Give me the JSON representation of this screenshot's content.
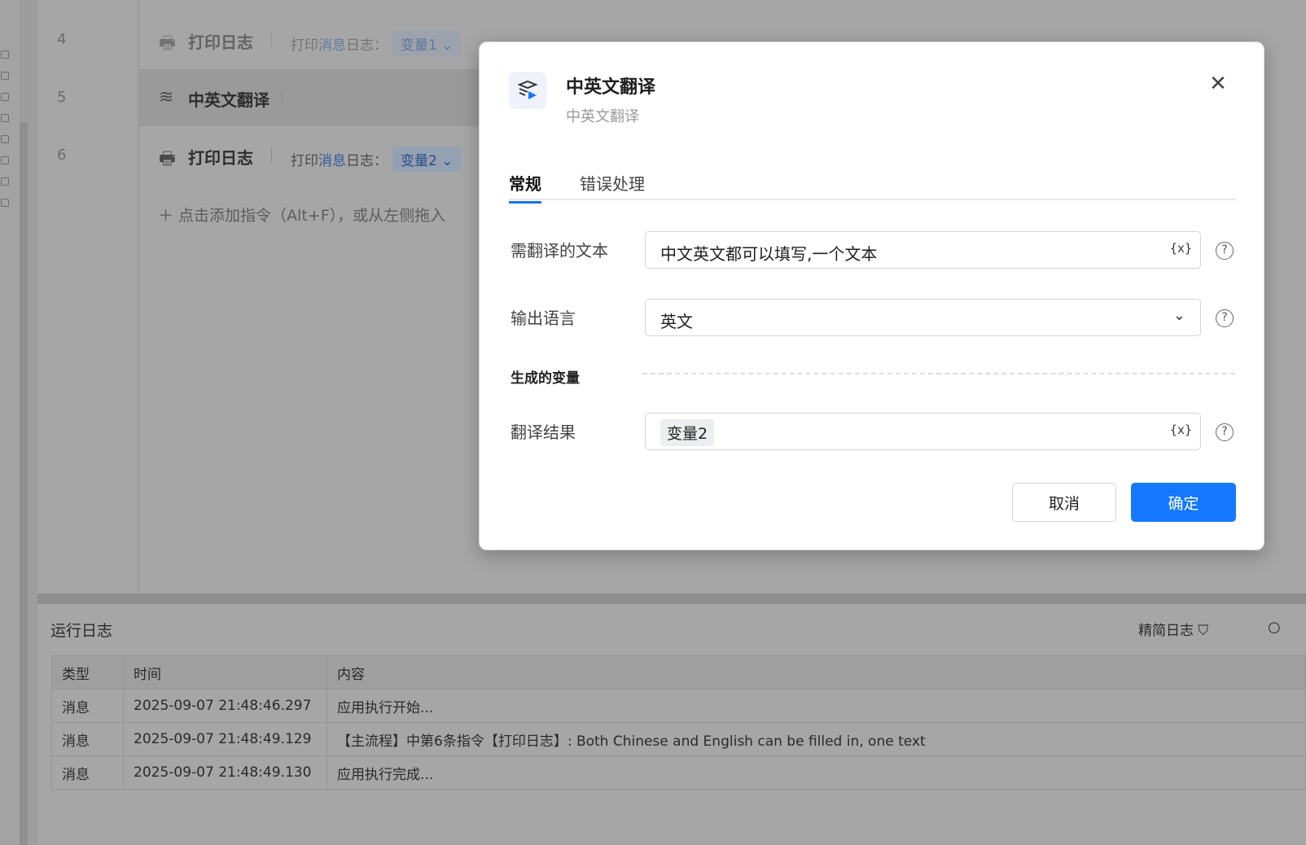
{
  "editor": {
    "rows": [
      {
        "line": "4",
        "icon": "printer-icon",
        "name": "打印日志",
        "desc_prefix": "打印",
        "desc_link": "消息",
        "desc_suffix": "日志：",
        "var": "变量1"
      },
      {
        "line": "5",
        "icon": "translate-icon",
        "name": "中英文翻译"
      },
      {
        "line": "6",
        "icon": "printer-icon",
        "name": "打印日志",
        "desc_prefix": "打印",
        "desc_link": "消息",
        "desc_suffix": "日志：",
        "var": "变量2"
      }
    ],
    "add_hint": "点击添加指令（Alt+F），或从左侧拖入"
  },
  "log": {
    "title": "运行日志",
    "filter_label": "精简日志",
    "columns": [
      "类型",
      "时间",
      "内容"
    ],
    "rows": [
      [
        "消息",
        "2025-09-07 21:48:46.297",
        "应用执行开始..."
      ],
      [
        "消息",
        "2025-09-07 21:48:49.129",
        "【主流程】中第6条指令【打印日志】: Both Chinese and English can be filled in, one text"
      ],
      [
        "消息",
        "2025-09-07 21:48:49.130",
        "应用执行完成..."
      ]
    ]
  },
  "dialog": {
    "title": "中英文翻译",
    "subtitle": "中英文翻译",
    "tabs": [
      "常规",
      "错误处理"
    ],
    "active_tab": "常规",
    "fields": {
      "text": {
        "label": "需翻译的文本",
        "value": "中文英文都可以填写,一个文本",
        "var_icon": "{x}"
      },
      "language": {
        "label": "输出语言",
        "value": "英文"
      },
      "section_title": "生成的变量",
      "result": {
        "label": "翻译结果",
        "value": "变量2",
        "var_icon": "{x}"
      }
    },
    "cancel_label": "取消",
    "ok_label": "确定"
  },
  "colors": {
    "accent": "#1677ff",
    "overlay": "#9d9d9d"
  }
}
